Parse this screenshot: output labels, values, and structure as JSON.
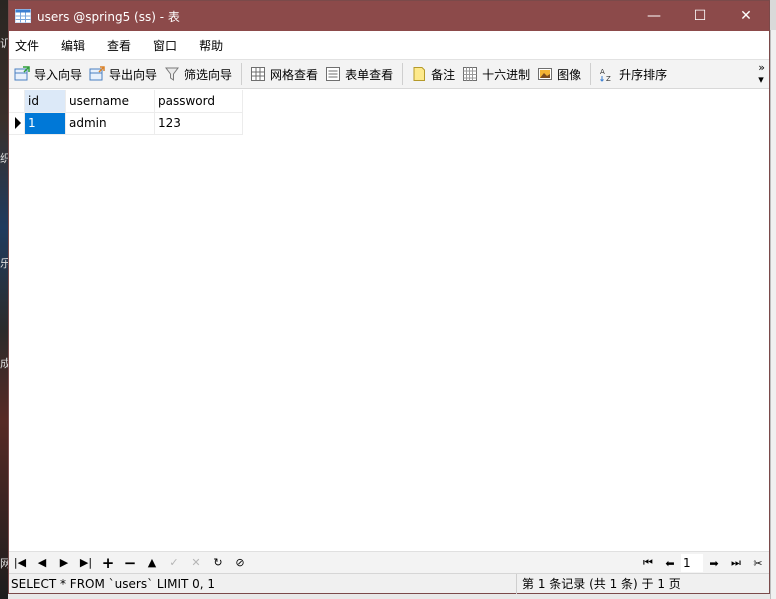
{
  "window": {
    "title": "users @spring5 (ss) - 表",
    "minimize_glyph": "—",
    "maximize_glyph": "☐",
    "close_glyph": "✕"
  },
  "desktop_fragments": [
    "讥",
    "织",
    "乐",
    "成",
    "网"
  ],
  "menu": [
    "文件",
    "编辑",
    "查看",
    "窗口",
    "帮助"
  ],
  "toolbar": {
    "import_wizard": "导入向导",
    "export_wizard": "导出向导",
    "filter_wizard": "筛选向导",
    "grid_view": "网格查看",
    "form_view": "表单查看",
    "memo": "备注",
    "hex": "十六进制",
    "image": "图像",
    "sort_asc": "升序排序",
    "more_glyph": "»"
  },
  "grid": {
    "columns": [
      "id",
      "username",
      "password"
    ],
    "rows": [
      {
        "id": "1",
        "username": "admin",
        "password": "123"
      }
    ]
  },
  "navigation": {
    "current_page": "1"
  },
  "status": {
    "sql": "SELECT * FROM `users` LIMIT 0, 1",
    "records": "第 1 条记录 (共 1 条) 于 1 页"
  }
}
